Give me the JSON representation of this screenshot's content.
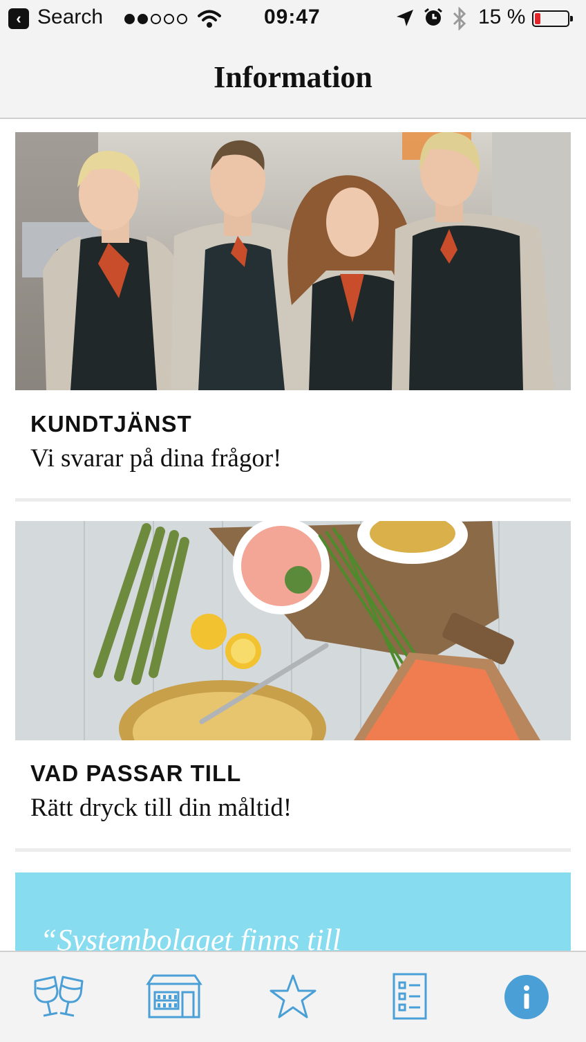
{
  "status_bar": {
    "back_label": "Search",
    "signal_dots_filled": 2,
    "signal_dots_total": 5,
    "time": "09:47",
    "battery_text": "15 %",
    "battery_level_percent": 15
  },
  "nav": {
    "title": "Information"
  },
  "cards": [
    {
      "title": "KUNDTJÄNST",
      "subtitle": "Vi svarar på dina frågor!",
      "image_icon": "staff-photo"
    },
    {
      "title": "VAD PASSAR TILL",
      "subtitle": "Rätt dryck till din måltid!",
      "image_icon": "food-photo"
    }
  ],
  "banner": {
    "quote": "“Systembolaget finns till"
  },
  "tabs": [
    {
      "icon": "wine-glasses-icon",
      "active": false
    },
    {
      "icon": "store-icon",
      "active": false
    },
    {
      "icon": "star-icon",
      "active": false
    },
    {
      "icon": "list-icon",
      "active": false
    },
    {
      "icon": "info-icon",
      "active": true
    }
  ],
  "colors": {
    "accent": "#4a9fd6",
    "bar_background": "#f3f3f3",
    "banner": "#88dcef",
    "battery_low": "#e0262b"
  }
}
